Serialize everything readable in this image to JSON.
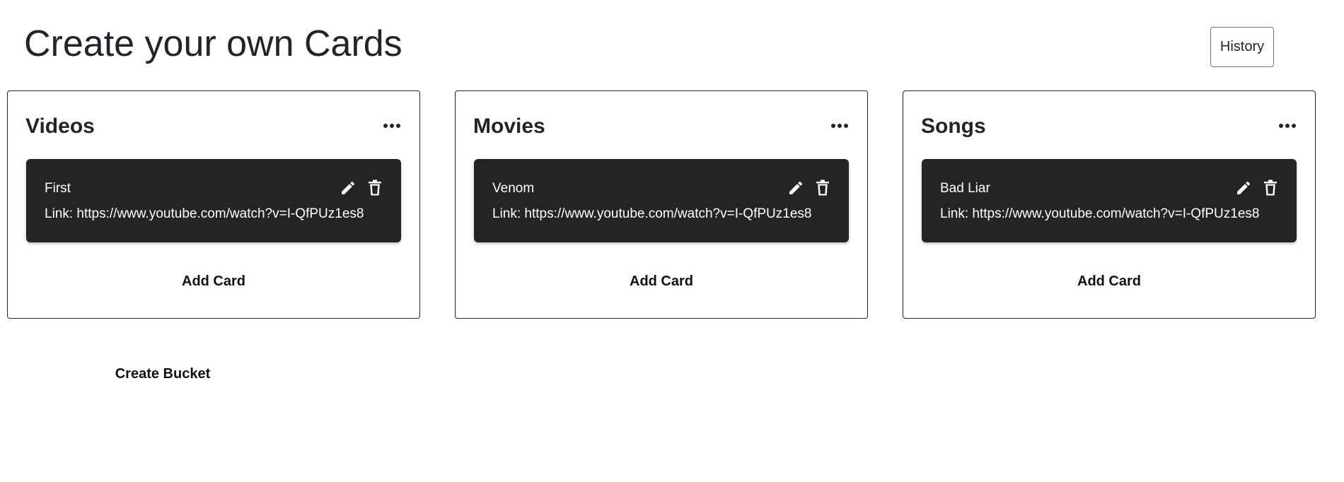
{
  "header": {
    "title": "Create your own Cards",
    "history_label": "History"
  },
  "buckets": [
    {
      "title": "Videos",
      "menu_icon": "more-horizontal-icon",
      "cards": [
        {
          "title": "First",
          "link": "Link: https://www.youtube.com/watch?v=I-QfPUz1es8"
        }
      ],
      "add_card_label": "Add Card"
    },
    {
      "title": "Movies",
      "menu_icon": "more-horizontal-icon",
      "cards": [
        {
          "title": "Venom",
          "link": "Link: https://www.youtube.com/watch?v=I-QfPUz1es8"
        }
      ],
      "add_card_label": "Add Card"
    },
    {
      "title": "Songs",
      "menu_icon": "more-horizontal-icon",
      "cards": [
        {
          "title": "Bad Liar",
          "link": "Link: https://www.youtube.com/watch?v=I-QfPUz1es8"
        }
      ],
      "add_card_label": "Add Card"
    }
  ],
  "footer": {
    "create_bucket_label": "Create Bucket"
  },
  "colors": {
    "card_background": "#242426",
    "text_primary": "#212529",
    "border": "#212529"
  },
  "icons": {
    "edit": "pencil-icon",
    "delete": "trash-icon"
  }
}
